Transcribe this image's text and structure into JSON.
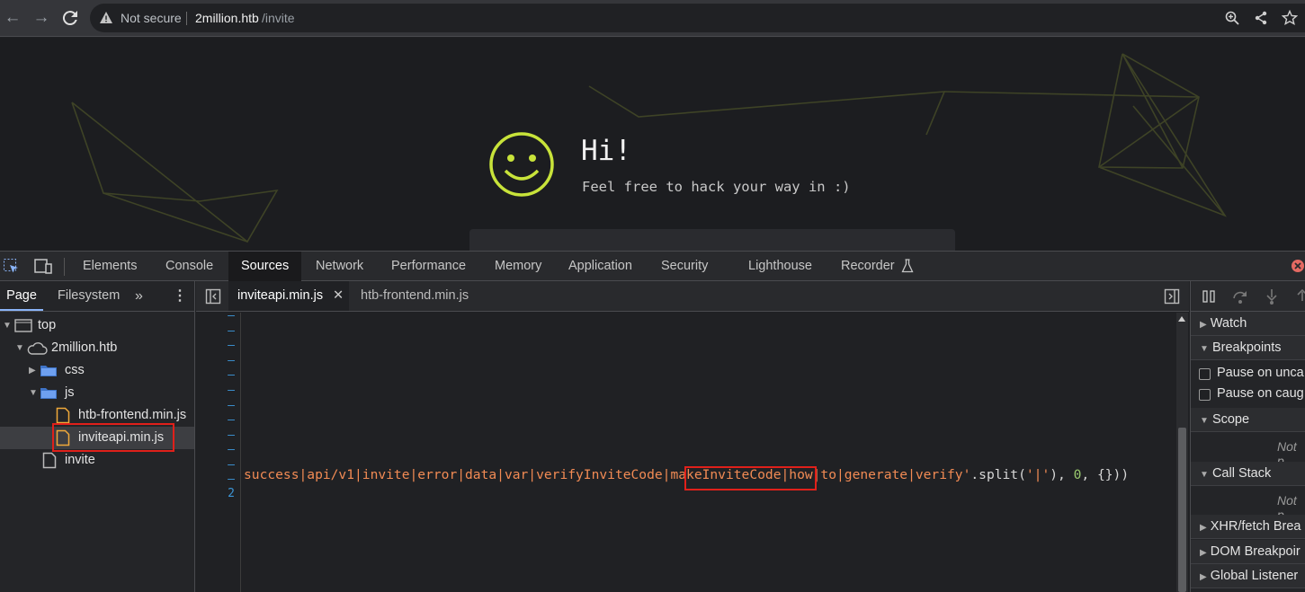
{
  "browser": {
    "not_secure": "Not secure",
    "url_host": "2million.htb",
    "url_path": "/invite",
    "icons": [
      "back-icon",
      "forward-icon",
      "reload-icon",
      "warning-icon",
      "zoom-icon",
      "share-icon",
      "star-icon"
    ]
  },
  "page": {
    "greeting": "Hi!",
    "subtitle": "Feel free to hack your way in :)",
    "accent_color": "#c8e33a"
  },
  "devtools": {
    "tabs": [
      "Elements",
      "Console",
      "Sources",
      "Network",
      "Performance",
      "Memory",
      "Application",
      "Security",
      "Lighthouse",
      "Recorder"
    ],
    "active_tab": "Sources",
    "navigator": {
      "tabs": [
        "Page",
        "Filesystem"
      ],
      "tree": [
        "top",
        "2million.htb",
        "css",
        "js",
        "htb-frontend.min.js",
        "inviteapi.min.js",
        "invite"
      ]
    },
    "editor": {
      "tabs": [
        "inviteapi.min.js",
        "htb-frontend.min.js"
      ],
      "line_number": "2",
      "code": {
        "seg1": "success|api/v1|invite|error|data|var|verifyInviteCode",
        "pipe1": "|",
        "highlight": "makeInviteCode",
        "pipe2": "|",
        "seg2": "how|to|generate|verify'",
        "call": ".split(",
        "sep": "'|'",
        "comma1": "), ",
        "zero": "0",
        "tail": ", {}))"
      }
    },
    "debugger": {
      "watch": "Watch",
      "breakpoints": "Breakpoints",
      "pause_uncaught": "Pause on unca",
      "pause_caught": "Pause on caug",
      "scope": "Scope",
      "not_paused": "Not p",
      "call_stack": "Call Stack",
      "xhr": "XHR/fetch Brea",
      "dom": "DOM Breakpoir",
      "global": "Global Listener"
    }
  }
}
